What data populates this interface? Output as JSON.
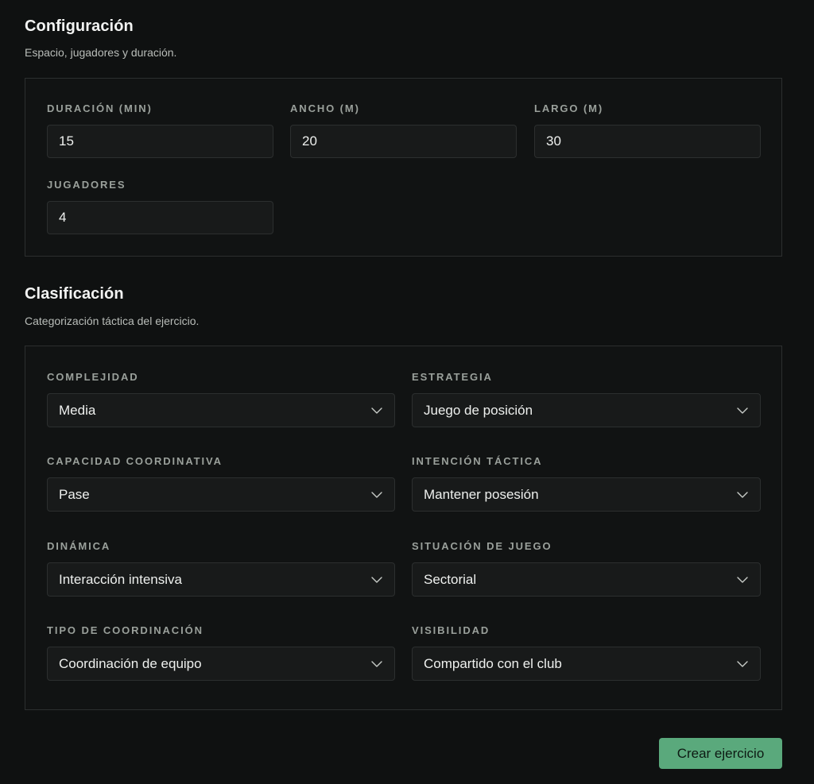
{
  "configuracion": {
    "title": "Configuración",
    "subtitle": "Espacio, jugadores y duración.",
    "fields": [
      {
        "label": "DURACIÓN (MIN)",
        "value": "15"
      },
      {
        "label": "ANCHO (M)",
        "value": "20"
      },
      {
        "label": "LARGO (M)",
        "value": "30"
      },
      {
        "label": "JUGADORES",
        "value": "4"
      }
    ]
  },
  "clasificacion": {
    "title": "Clasificación",
    "subtitle": "Categorización táctica del ejercicio.",
    "selects": [
      {
        "label": "COMPLEJIDAD",
        "value": "Media"
      },
      {
        "label": "ESTRATEGIA",
        "value": "Juego de posición"
      },
      {
        "label": "CAPACIDAD COORDINATIVA",
        "value": "Pase"
      },
      {
        "label": "INTENCIÓN TÁCTICA",
        "value": "Mantener posesión"
      },
      {
        "label": "DINÁMICA",
        "value": "Interacción intensiva"
      },
      {
        "label": "SITUACIÓN DE JUEGO",
        "value": "Sectorial"
      },
      {
        "label": "TIPO DE COORDINACIÓN",
        "value": "Coordinación de equipo"
      },
      {
        "label": "VISIBILIDAD",
        "value": "Compartido con el club"
      }
    ]
  },
  "actions": {
    "submit_label": "Crear ejercicio"
  },
  "icons": {
    "select_chevron": "chevron-down-icon"
  },
  "colors": {
    "background": "#0f1111",
    "panel_border": "#2c2f2f",
    "input_background": "#181a1a",
    "accent": "#5aa97c"
  }
}
